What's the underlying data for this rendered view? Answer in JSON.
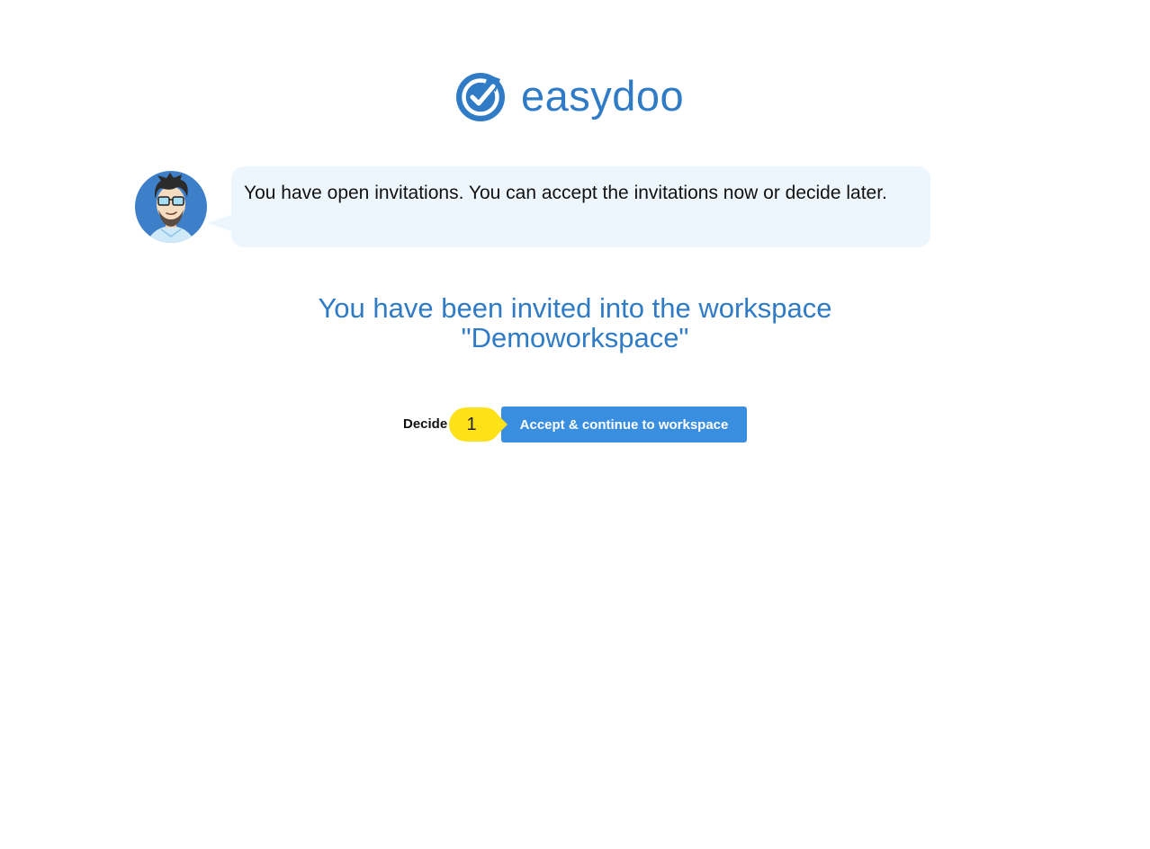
{
  "brand": {
    "name": "easydoo",
    "color": "#2f7bc6"
  },
  "assistant": {
    "avatar_icon": "user-avatar-icon",
    "message": "You have open invitations. You can accept the invitations now or decide later."
  },
  "invitation": {
    "heading_line1": "You have been invited into the workspace",
    "heading_line2": "\"Demoworkspace\""
  },
  "actions": {
    "decide_later_label": "Decide later",
    "accept_label": "Accept & continue to workspace",
    "accent_color": "#3a8ee0"
  },
  "step_marker": {
    "number": "1",
    "color": "#ffe11a"
  }
}
